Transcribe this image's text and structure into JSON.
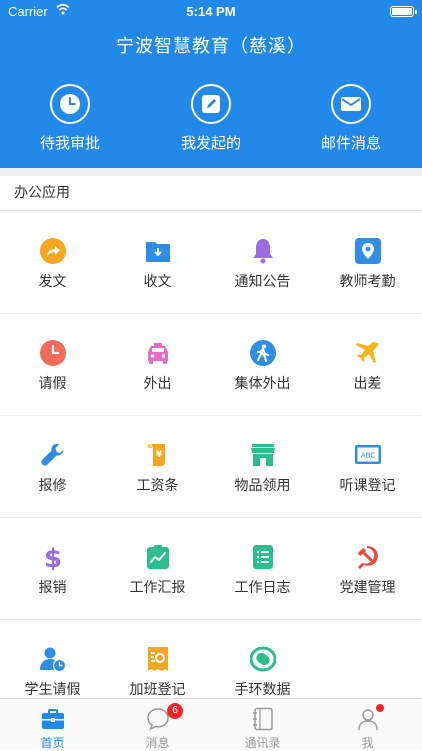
{
  "status_bar": {
    "carrier": "Carrier",
    "time": "5:14 PM"
  },
  "header": {
    "title": "宁波智慧教育（慈溪）",
    "quick_actions": [
      {
        "label": "待我审批",
        "icon": "clock-icon"
      },
      {
        "label": "我发起的",
        "icon": "edit-icon"
      },
      {
        "label": "邮件消息",
        "icon": "mail-icon"
      }
    ]
  },
  "section": {
    "title": "办公应用"
  },
  "apps": [
    {
      "label": "发文",
      "icon": "share-arrow-icon",
      "color": "#f5a623"
    },
    {
      "label": "收文",
      "icon": "inbox-folder-icon",
      "color": "#2f8de4"
    },
    {
      "label": "通知公告",
      "icon": "bell-icon",
      "color": "#9b6de0"
    },
    {
      "label": "教师考勤",
      "icon": "location-pin-icon",
      "color": "#2f8de4"
    },
    {
      "label": "请假",
      "icon": "clock-icon",
      "color": "#ef6b5b"
    },
    {
      "label": "外出",
      "icon": "taxi-icon",
      "color": "#e86bc6"
    },
    {
      "label": "集体外出",
      "icon": "walking-person-icon",
      "color": "#2f8de4"
    },
    {
      "label": "出差",
      "icon": "airplane-icon",
      "color": "#f5b51e"
    },
    {
      "label": "报修",
      "icon": "wrench-icon",
      "color": "#2f8de4"
    },
    {
      "label": "工资条",
      "icon": "yen-scroll-icon",
      "color": "#f5a623"
    },
    {
      "label": "物品领用",
      "icon": "store-icon",
      "color": "#2ebd8c"
    },
    {
      "label": "听课登记",
      "icon": "abc-board-icon",
      "color": "#2f8de4"
    },
    {
      "label": "报销",
      "icon": "dollar-icon",
      "color": "#9b6de0"
    },
    {
      "label": "工作汇报",
      "icon": "chart-clipboard-icon",
      "color": "#2ebd8c"
    },
    {
      "label": "工作日志",
      "icon": "list-document-icon",
      "color": "#2ebd8c"
    },
    {
      "label": "党建管理",
      "icon": "hammer-sickle-icon",
      "color": "#e84b3a"
    },
    {
      "label": "学生请假",
      "icon": "student-clock-icon",
      "color": "#2f8de4"
    },
    {
      "label": "加班登记",
      "icon": "overtime-receipt-icon",
      "color": "#f5a623"
    },
    {
      "label": "手环数据",
      "icon": "wristband-icon",
      "color": "#2ebd8c"
    }
  ],
  "tabbar": {
    "tabs": [
      {
        "label": "首页",
        "icon": "briefcase-icon",
        "active": true
      },
      {
        "label": "消息",
        "icon": "chat-bubble-icon",
        "badge": "6"
      },
      {
        "label": "通讯录",
        "icon": "address-book-icon"
      },
      {
        "label": "我",
        "icon": "person-icon",
        "dot": true
      }
    ]
  },
  "colors": {
    "brand": "#2389e8",
    "badge": "#f2242a",
    "tab_inactive": "#999999"
  }
}
